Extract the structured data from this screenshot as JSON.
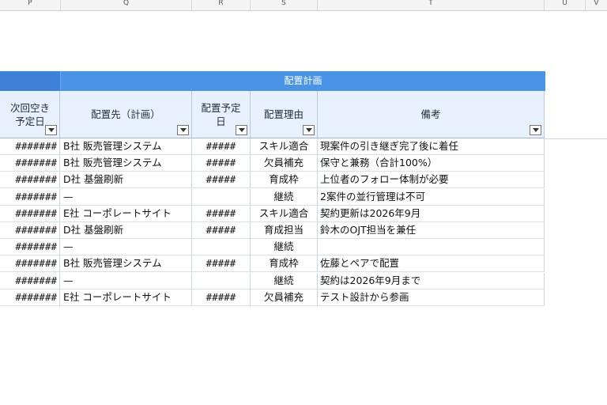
{
  "column_headers": [
    "P",
    "Q",
    "R",
    "S",
    "T",
    "U",
    "V"
  ],
  "group_header": "配置計画",
  "headers": {
    "p": "次回空き予定日",
    "q": "配置先（計画）",
    "r": "配置予定日",
    "s": "配置理由",
    "t": "備考"
  },
  "rows": [
    {
      "p": "#######",
      "q": "B社 販売管理システム",
      "r": "#####",
      "s": "スキル適合",
      "t": "現案件の引き継ぎ完了後に着任"
    },
    {
      "p": "#######",
      "q": "B社 販売管理システム",
      "r": "#####",
      "s": "欠員補充",
      "t": "保守と兼務（合計100%）"
    },
    {
      "p": "#######",
      "q": "D社 基盤刷新",
      "r": "#####",
      "s": "育成枠",
      "t": "上位者のフォロー体制が必要"
    },
    {
      "p": "#######",
      "q": "—",
      "r": "",
      "s": "継続",
      "t": "2案件の並行管理は不可"
    },
    {
      "p": "#######",
      "q": "E社 コーポレートサイト",
      "r": "#####",
      "s": "スキル適合",
      "t": "契約更新は2026年9月"
    },
    {
      "p": "#######",
      "q": "D社 基盤刷新",
      "r": "#####",
      "s": "育成担当",
      "t": "鈴木のOJT担当を兼任"
    },
    {
      "p": "#######",
      "q": "—",
      "r": "",
      "s": "継続",
      "t": ""
    },
    {
      "p": "#######",
      "q": "B社 販売管理システム",
      "r": "#####",
      "s": "育成枠",
      "t": "佐藤とペアで配置"
    },
    {
      "p": "#######",
      "q": "—",
      "r": "",
      "s": "継続",
      "t": "契約は2026年9月まで"
    },
    {
      "p": "#######",
      "q": "E社 コーポレートサイト",
      "r": "#####",
      "s": "欠員補充",
      "t": "テスト設計から参画"
    }
  ],
  "colors": {
    "group_bg": "#4a94e8",
    "header_bg": "#e8f1fb"
  }
}
